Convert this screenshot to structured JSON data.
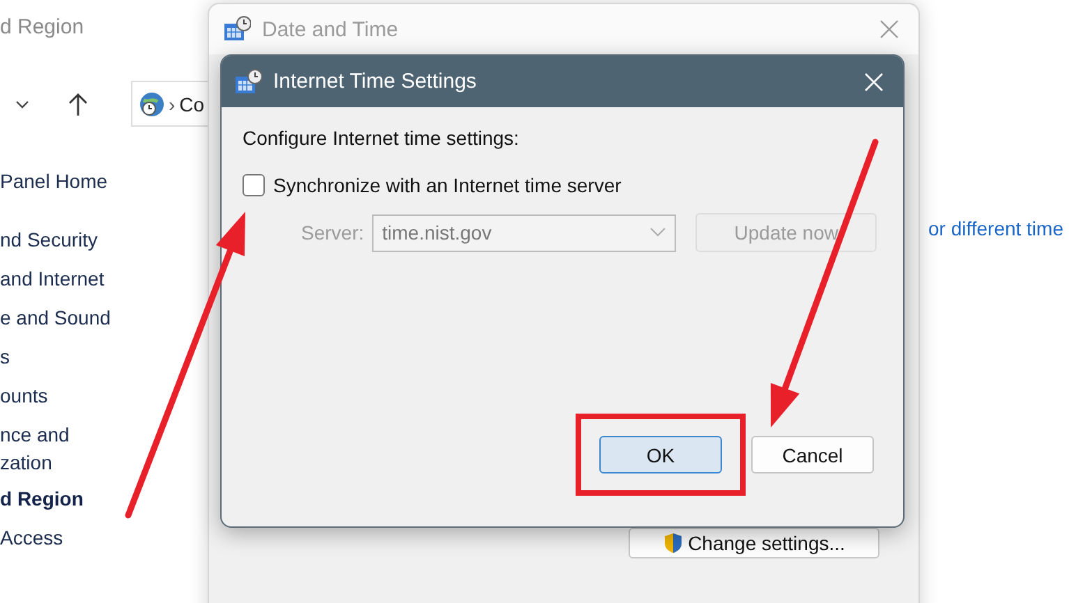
{
  "control_panel": {
    "title": "d Region",
    "address_separator": "›",
    "address": "Co",
    "sidebar": {
      "items": [
        {
          "label": "Panel Home",
          "selected": false
        },
        {
          "label": "nd Security",
          "selected": false
        },
        {
          "label": "and Internet",
          "selected": false
        },
        {
          "label": "e and Sound",
          "selected": false
        },
        {
          "label": "s",
          "selected": false
        },
        {
          "label": "ounts",
          "selected": false
        },
        {
          "label": "nce and\nzation",
          "selected": false
        },
        {
          "label": "d Region",
          "selected": true
        },
        {
          "label": "Access",
          "selected": false
        }
      ]
    },
    "link": "or different time"
  },
  "date_time_window": {
    "title": "Date and Time",
    "change_settings_button": "Change settings..."
  },
  "dialog": {
    "title": "Internet Time Settings",
    "heading": "Configure Internet time settings:",
    "sync": {
      "label": "Synchronize with an Internet time server",
      "checked": false
    },
    "server": {
      "label": "Server:",
      "value": "time.nist.gov",
      "disabled": true
    },
    "update_button": {
      "label": "Update now",
      "disabled": true
    },
    "buttons": [
      {
        "label": "OK",
        "default": true,
        "highlighted": true
      },
      {
        "label": "Cancel",
        "default": false,
        "highlighted": false
      }
    ]
  },
  "annotations": [
    {
      "kind": "arrow"
    },
    {
      "kind": "arrow"
    }
  ]
}
